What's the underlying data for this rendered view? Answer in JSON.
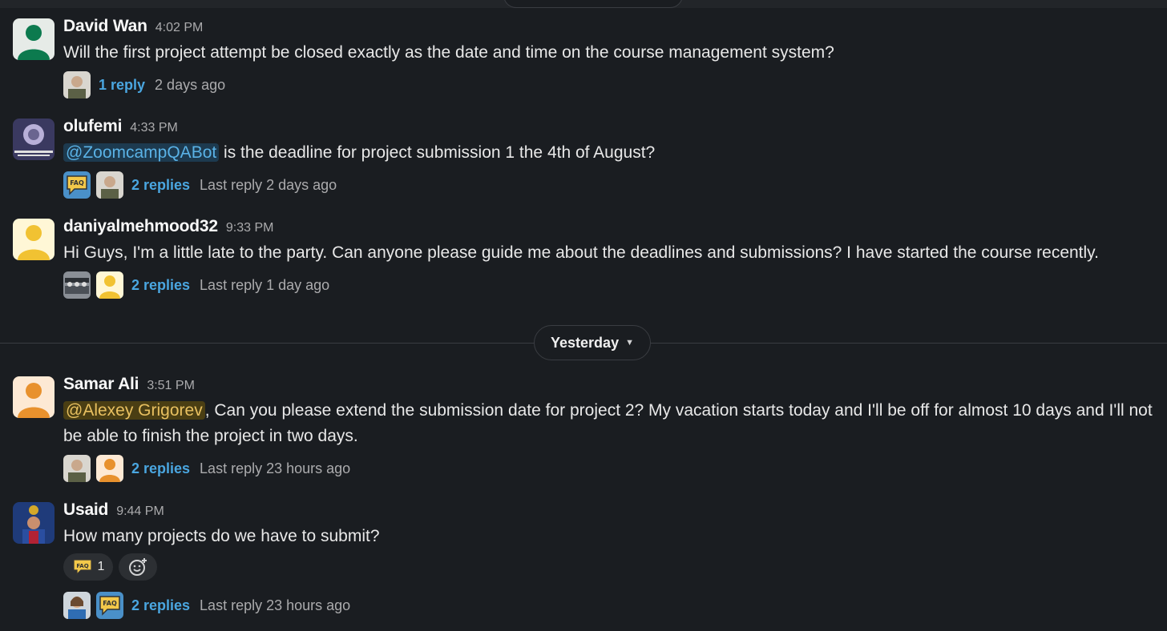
{
  "messages": [
    {
      "name": "David Wan",
      "time": "4:02 PM",
      "text": "Will the first project attempt be closed exactly as the date and time on the course management system?",
      "replies": "1 reply",
      "last": "2 days ago"
    },
    {
      "name": "olufemi",
      "time": "4:33 PM",
      "mention": "@ZoomcampQABot",
      "text": " is the deadline for project submission 1 the 4th of August?",
      "replies": "2 replies",
      "last": "Last reply 2 days ago"
    },
    {
      "name": "daniyalmehmood32",
      "time": "9:33 PM",
      "text": "Hi Guys, I'm a little late to the party. Can anyone please guide me about the deadlines and submissions? I have started the course recently.",
      "replies": "2 replies",
      "last": "Last reply 1 day ago"
    },
    {
      "name": "Samar Ali",
      "time": "3:51 PM",
      "mention": "@Alexey Grigorev",
      "text": ", Can you please extend the submission date for project 2? My vacation starts today and I'll be off for almost 10 days and I'll not be able to finish the project in two days.",
      "replies": "2 replies",
      "last": "Last reply 23 hours ago"
    },
    {
      "name": "Usaid",
      "time": "9:44 PM",
      "text": "How many projects do we have to submit?",
      "reaction_count": "1",
      "replies": "2 replies",
      "last": "Last reply 23 hours ago"
    }
  ],
  "day_divider": "Yesterday",
  "faq_label": "FAQ",
  "colors": {
    "background": "#1a1d21",
    "link": "#4aa6e0",
    "mention_bg": "#1d3a4f",
    "self_mention_bg": "#4a3e13"
  }
}
